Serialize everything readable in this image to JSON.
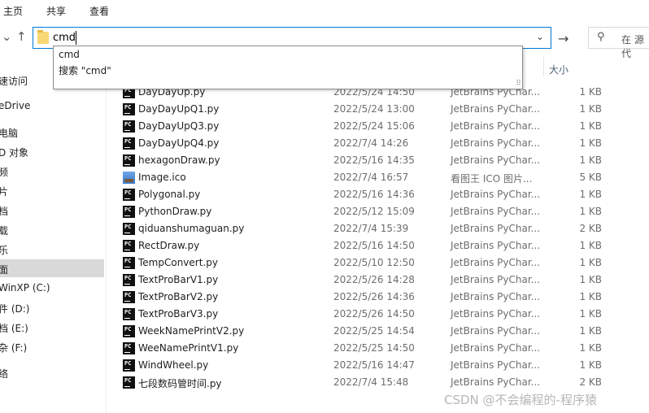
{
  "ribbon": {
    "tabs": [
      "主页",
      "共享",
      "查看"
    ]
  },
  "address": {
    "value": "cmd"
  },
  "search": {
    "placeholder": "在 源代"
  },
  "suggestions": [
    "cmd",
    "搜索 \"cmd\""
  ],
  "sidebar": {
    "items": [
      {
        "label": "速访问",
        "selected": false
      },
      {
        "label": "eDrive",
        "selected": false
      },
      {
        "label": "电脑",
        "selected": false
      },
      {
        "label": "D 对象",
        "selected": false
      },
      {
        "label": "频",
        "selected": false
      },
      {
        "label": "片",
        "selected": false
      },
      {
        "label": "档",
        "selected": false
      },
      {
        "label": "载",
        "selected": false
      },
      {
        "label": "乐",
        "selected": false
      },
      {
        "label": "面",
        "selected": true
      },
      {
        "label": "WinXP (C:)",
        "selected": false
      },
      {
        "label": "件 (D:)",
        "selected": false
      },
      {
        "label": "档 (E:)",
        "selected": false
      },
      {
        "label": "杂 (F:)",
        "selected": false
      },
      {
        "label": "络",
        "selected": false
      }
    ]
  },
  "columns": {
    "size": "大小"
  },
  "files": [
    {
      "name": "DayDayUp.py",
      "date": "2022/5/24 14:50",
      "type": "JetBrains PyChar...",
      "size": "1 KB",
      "icon": "pycharm-file-icon"
    },
    {
      "name": "DayDayUpQ1.py",
      "date": "2022/5/24 13:00",
      "type": "JetBrains PyChar...",
      "size": "1 KB",
      "icon": "pycharm-file-icon"
    },
    {
      "name": "DayDayUpQ3.py",
      "date": "2022/5/24 15:06",
      "type": "JetBrains PyChar...",
      "size": "1 KB",
      "icon": "pycharm-file-icon"
    },
    {
      "name": "DayDayUpQ4.py",
      "date": "2022/7/4 14:26",
      "type": "JetBrains PyChar...",
      "size": "1 KB",
      "icon": "pycharm-file-icon"
    },
    {
      "name": "hexagonDraw.py",
      "date": "2022/5/16 14:35",
      "type": "JetBrains PyChar...",
      "size": "1 KB",
      "icon": "pycharm-file-icon"
    },
    {
      "name": "Image.ico",
      "date": "2022/7/4 16:57",
      "type": "看图王 ICO 图片...",
      "size": "5 KB",
      "icon": "image-file-icon"
    },
    {
      "name": "Polygonal.py",
      "date": "2022/5/16 14:36",
      "type": "JetBrains PyChar...",
      "size": "1 KB",
      "icon": "pycharm-file-icon"
    },
    {
      "name": "PythonDraw.py",
      "date": "2022/5/12 15:09",
      "type": "JetBrains PyChar...",
      "size": "1 KB",
      "icon": "pycharm-file-icon"
    },
    {
      "name": "qiduanshumaguan.py",
      "date": "2022/7/4 15:39",
      "type": "JetBrains PyChar...",
      "size": "2 KB",
      "icon": "pycharm-file-icon"
    },
    {
      "name": "RectDraw.py",
      "date": "2022/5/16 14:50",
      "type": "JetBrains PyChar...",
      "size": "1 KB",
      "icon": "pycharm-file-icon"
    },
    {
      "name": "TempConvert.py",
      "date": "2022/5/10 12:50",
      "type": "JetBrains PyChar...",
      "size": "1 KB",
      "icon": "pycharm-file-icon"
    },
    {
      "name": "TextProBarV1.py",
      "date": "2022/5/26 14:28",
      "type": "JetBrains PyChar...",
      "size": "1 KB",
      "icon": "pycharm-file-icon"
    },
    {
      "name": "TextProBarV2.py",
      "date": "2022/5/26 14:36",
      "type": "JetBrains PyChar...",
      "size": "1 KB",
      "icon": "pycharm-file-icon"
    },
    {
      "name": "TextProBarV3.py",
      "date": "2022/5/26 14:50",
      "type": "JetBrains PyChar...",
      "size": "1 KB",
      "icon": "pycharm-file-icon"
    },
    {
      "name": "WeekNamePrintV2.py",
      "date": "2022/5/25 14:54",
      "type": "JetBrains PyChar...",
      "size": "1 KB",
      "icon": "pycharm-file-icon"
    },
    {
      "name": "WeeNamePrintV1.py",
      "date": "2022/5/25 14:50",
      "type": "JetBrains PyChar...",
      "size": "1 KB",
      "icon": "pycharm-file-icon"
    },
    {
      "name": "WindWheel.py",
      "date": "2022/5/16 14:47",
      "type": "JetBrains PyChar...",
      "size": "1 KB",
      "icon": "pycharm-file-icon"
    },
    {
      "name": "七段数码管时间.py",
      "date": "2022/7/4 15:48",
      "type": "JetBrains PyChar...",
      "size": "2 KB",
      "icon": "pycharm-file-icon"
    }
  ],
  "watermark": "CSDN @不会编程的-程序猿",
  "colors": {
    "accent": "#0078d7",
    "selected": "#d9d9d9"
  }
}
